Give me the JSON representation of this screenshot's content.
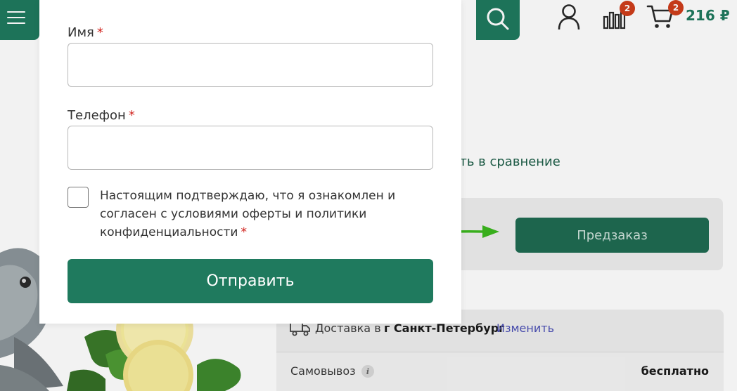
{
  "header": {
    "cart_total": "216 ₽",
    "compare_badge": "2",
    "cart_badge": "2"
  },
  "product": {
    "compare_link": "авить в сравнение",
    "preorder_label": "Предзаказ"
  },
  "delivery": {
    "label": "Доставка в",
    "city": "г Санкт-Петербург",
    "change_label": "Изменить",
    "pickup_label": "Самовывоз",
    "pickup_price": "бесплатно",
    "info_glyph": "i"
  },
  "form": {
    "name_label": "Имя",
    "phone_label": "Телефон",
    "required_mark": "*",
    "name_value": "",
    "phone_value": "",
    "consent_text": "Настоящим подтверждаю, что я ознакомлен и согласен с условиями оферты и политики конфиденциальности",
    "submit_label": "Отправить"
  },
  "colors": {
    "brand_green": "#1f7a5e",
    "badge_red": "#cf3e1b",
    "required_red": "#d0211c",
    "arrow_green": "#3cb81e",
    "link_blue": "#4a4fb5"
  },
  "icons": {
    "menu": "menu-icon",
    "search": "search-icon",
    "user": "user-icon",
    "compare": "compare-chart-icon",
    "cart": "cart-icon",
    "truck": "truck-icon",
    "info": "info-icon",
    "arrow": "arrow-right-icon"
  }
}
